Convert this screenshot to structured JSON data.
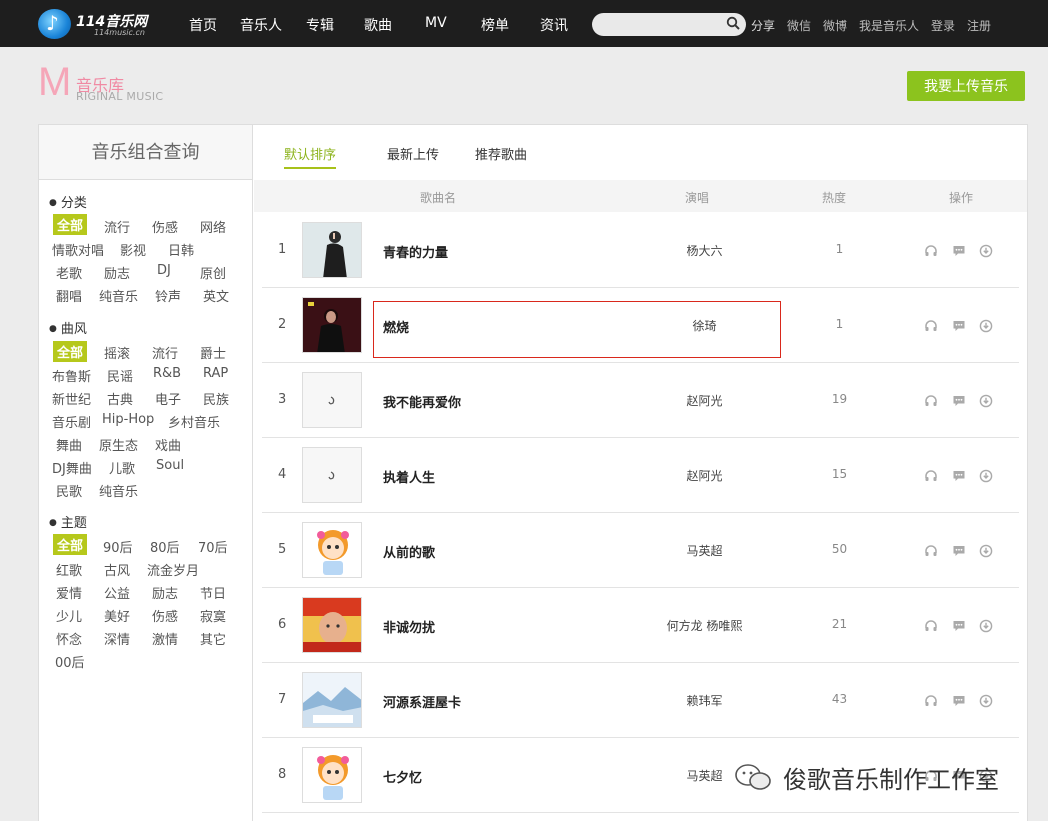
{
  "nav": {
    "logo_text": "114音乐网",
    "logo_sub": "114music.cn",
    "items": [
      "首页",
      "音乐人",
      "专辑",
      "歌曲",
      "MV",
      "榜单",
      "资讯"
    ],
    "search_placeholder": "",
    "links": [
      "分享",
      "微信",
      "微博",
      "我是音乐人",
      "登录",
      "注册"
    ]
  },
  "header": {
    "logo_letter": "M",
    "logo_cn": "音乐库",
    "logo_en": "RIGINAL MUSIC",
    "upload_label": "我要上传音乐"
  },
  "sidebar": {
    "title": "音乐组合查询",
    "groups": [
      {
        "title": "分类",
        "tags": [
          "全部",
          "流行",
          "伤感",
          "网络",
          "情歌对唱",
          "影视",
          "日韩",
          "老歌",
          "励志",
          "DJ",
          "原创",
          "翻唱",
          "纯音乐",
          "铃声",
          "英文"
        ]
      },
      {
        "title": "曲风",
        "tags": [
          "全部",
          "摇滚",
          "流行",
          "爵士",
          "布鲁斯",
          "民谣",
          "R&B",
          "RAP",
          "新世纪",
          "古典",
          "电子",
          "民族",
          "音乐剧",
          "Hip-Hop",
          "乡村音乐",
          "舞曲",
          "原生态",
          "戏曲",
          "DJ舞曲",
          "儿歌",
          "Soul",
          "民歌",
          "纯音乐"
        ]
      },
      {
        "title": "主题",
        "tags": [
          "全部",
          "90后",
          "80后",
          "70后",
          "红歌",
          "古风",
          "流金岁月",
          "爱情",
          "公益",
          "励志",
          "节日",
          "少儿",
          "美好",
          "伤感",
          "寂寞",
          "怀念",
          "深情",
          "激情",
          "其它",
          "00后"
        ]
      }
    ]
  },
  "main": {
    "tabs": [
      "默认排序",
      "最新上传",
      "推荐歌曲"
    ],
    "columns": {
      "song": "歌曲名",
      "singer": "演唱",
      "heat": "热度",
      "ops": "操作"
    },
    "rows": [
      {
        "num": "1",
        "song": "青春的力量",
        "singer": "杨大六",
        "heat": "1",
        "cover": "portrait-woman"
      },
      {
        "num": "2",
        "song": "燃烧",
        "singer": "徐琦",
        "heat": "1",
        "cover": "portrait-dark"
      },
      {
        "num": "3",
        "song": "我不能再爱你",
        "singer": "赵阿光",
        "heat": "19",
        "cover": "placeholder"
      },
      {
        "num": "4",
        "song": "执着人生",
        "singer": "赵阿光",
        "heat": "15",
        "cover": "placeholder"
      },
      {
        "num": "5",
        "song": "从前的歌",
        "singer": "马英超",
        "heat": "50",
        "cover": "cartoon-girl"
      },
      {
        "num": "6",
        "song": "非诚勿扰",
        "singer": "何方龙 杨唯熙",
        "heat": "21",
        "cover": "portrait-man"
      },
      {
        "num": "7",
        "song": "河源系涯屋卡",
        "singer": "赖玮军",
        "heat": "43",
        "cover": "landscape-snow"
      },
      {
        "num": "8",
        "song": "七夕忆",
        "singer": "马英超",
        "heat": "",
        "cover": "cartoon-girl"
      }
    ]
  },
  "watermark": {
    "text": "俊歌音乐制作工作室"
  },
  "colors": {
    "accent_green": "#8cc31e",
    "tag_active": "#b6c81b",
    "highlight_red": "#d9281c",
    "topbar": "#1e1e1e"
  }
}
